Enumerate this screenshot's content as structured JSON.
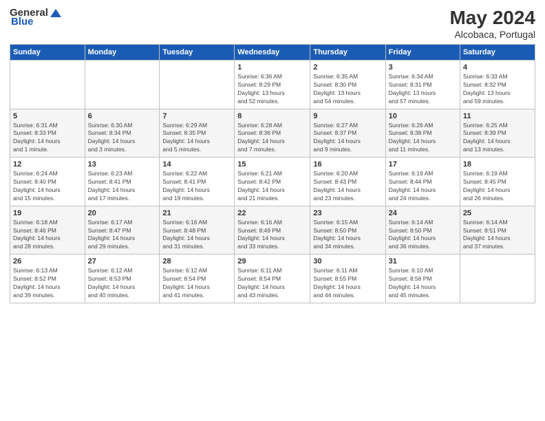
{
  "header": {
    "logo_general": "General",
    "logo_blue": "Blue",
    "title": "May 2024",
    "subtitle": "Alcobaca, Portugal"
  },
  "weekdays": [
    "Sunday",
    "Monday",
    "Tuesday",
    "Wednesday",
    "Thursday",
    "Friday",
    "Saturday"
  ],
  "weeks": [
    [
      {
        "day": "",
        "info": ""
      },
      {
        "day": "",
        "info": ""
      },
      {
        "day": "",
        "info": ""
      },
      {
        "day": "1",
        "info": "Sunrise: 6:36 AM\nSunset: 8:29 PM\nDaylight: 13 hours\nand 52 minutes."
      },
      {
        "day": "2",
        "info": "Sunrise: 6:35 AM\nSunset: 8:30 PM\nDaylight: 13 hours\nand 54 minutes."
      },
      {
        "day": "3",
        "info": "Sunrise: 6:34 AM\nSunset: 8:31 PM\nDaylight: 13 hours\nand 57 minutes."
      },
      {
        "day": "4",
        "info": "Sunrise: 6:33 AM\nSunset: 8:32 PM\nDaylight: 13 hours\nand 59 minutes."
      }
    ],
    [
      {
        "day": "5",
        "info": "Sunrise: 6:31 AM\nSunset: 8:33 PM\nDaylight: 14 hours\nand 1 minute."
      },
      {
        "day": "6",
        "info": "Sunrise: 6:30 AM\nSunset: 8:34 PM\nDaylight: 14 hours\nand 3 minutes."
      },
      {
        "day": "7",
        "info": "Sunrise: 6:29 AM\nSunset: 8:35 PM\nDaylight: 14 hours\nand 5 minutes."
      },
      {
        "day": "8",
        "info": "Sunrise: 6:28 AM\nSunset: 8:36 PM\nDaylight: 14 hours\nand 7 minutes."
      },
      {
        "day": "9",
        "info": "Sunrise: 6:27 AM\nSunset: 8:37 PM\nDaylight: 14 hours\nand 9 minutes."
      },
      {
        "day": "10",
        "info": "Sunrise: 6:26 AM\nSunset: 8:38 PM\nDaylight: 14 hours\nand 11 minutes."
      },
      {
        "day": "11",
        "info": "Sunrise: 6:25 AM\nSunset: 8:39 PM\nDaylight: 14 hours\nand 13 minutes."
      }
    ],
    [
      {
        "day": "12",
        "info": "Sunrise: 6:24 AM\nSunset: 8:40 PM\nDaylight: 14 hours\nand 15 minutes."
      },
      {
        "day": "13",
        "info": "Sunrise: 6:23 AM\nSunset: 8:41 PM\nDaylight: 14 hours\nand 17 minutes."
      },
      {
        "day": "14",
        "info": "Sunrise: 6:22 AM\nSunset: 8:41 PM\nDaylight: 14 hours\nand 19 minutes."
      },
      {
        "day": "15",
        "info": "Sunrise: 6:21 AM\nSunset: 8:42 PM\nDaylight: 14 hours\nand 21 minutes."
      },
      {
        "day": "16",
        "info": "Sunrise: 6:20 AM\nSunset: 8:43 PM\nDaylight: 14 hours\nand 23 minutes."
      },
      {
        "day": "17",
        "info": "Sunrise: 6:19 AM\nSunset: 8:44 PM\nDaylight: 14 hours\nand 24 minutes."
      },
      {
        "day": "18",
        "info": "Sunrise: 6:19 AM\nSunset: 8:45 PM\nDaylight: 14 hours\nand 26 minutes."
      }
    ],
    [
      {
        "day": "19",
        "info": "Sunrise: 6:18 AM\nSunset: 8:46 PM\nDaylight: 14 hours\nand 28 minutes."
      },
      {
        "day": "20",
        "info": "Sunrise: 6:17 AM\nSunset: 8:47 PM\nDaylight: 14 hours\nand 29 minutes."
      },
      {
        "day": "21",
        "info": "Sunrise: 6:16 AM\nSunset: 8:48 PM\nDaylight: 14 hours\nand 31 minutes."
      },
      {
        "day": "22",
        "info": "Sunrise: 6:16 AM\nSunset: 8:49 PM\nDaylight: 14 hours\nand 33 minutes."
      },
      {
        "day": "23",
        "info": "Sunrise: 6:15 AM\nSunset: 8:50 PM\nDaylight: 14 hours\nand 34 minutes."
      },
      {
        "day": "24",
        "info": "Sunrise: 6:14 AM\nSunset: 8:50 PM\nDaylight: 14 hours\nand 36 minutes."
      },
      {
        "day": "25",
        "info": "Sunrise: 6:14 AM\nSunset: 8:51 PM\nDaylight: 14 hours\nand 37 minutes."
      }
    ],
    [
      {
        "day": "26",
        "info": "Sunrise: 6:13 AM\nSunset: 8:52 PM\nDaylight: 14 hours\nand 39 minutes."
      },
      {
        "day": "27",
        "info": "Sunrise: 6:12 AM\nSunset: 8:53 PM\nDaylight: 14 hours\nand 40 minutes."
      },
      {
        "day": "28",
        "info": "Sunrise: 6:12 AM\nSunset: 8:54 PM\nDaylight: 14 hours\nand 41 minutes."
      },
      {
        "day": "29",
        "info": "Sunrise: 6:11 AM\nSunset: 8:54 PM\nDaylight: 14 hours\nand 43 minutes."
      },
      {
        "day": "30",
        "info": "Sunrise: 6:11 AM\nSunset: 8:55 PM\nDaylight: 14 hours\nand 44 minutes."
      },
      {
        "day": "31",
        "info": "Sunrise: 6:10 AM\nSunset: 8:56 PM\nDaylight: 14 hours\nand 45 minutes."
      },
      {
        "day": "",
        "info": ""
      }
    ]
  ]
}
